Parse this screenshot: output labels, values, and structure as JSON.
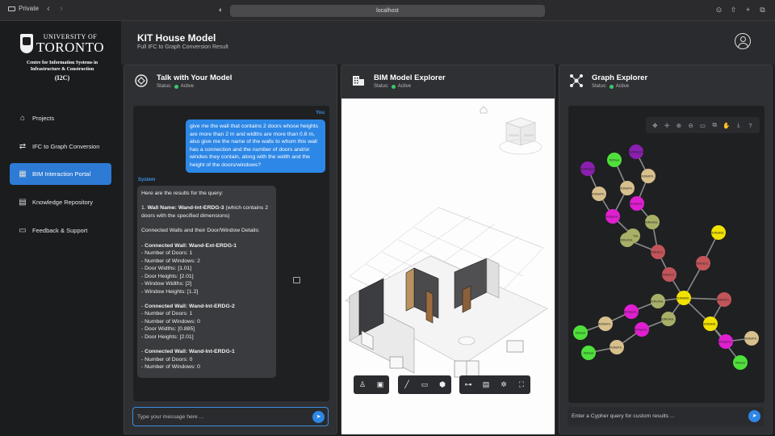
{
  "browser": {
    "private_label": "Private",
    "url": "localhost"
  },
  "sidebar": {
    "logo": {
      "line1": "UNIVERSITY OF",
      "line2": "TORONTO",
      "centre": "Centre for Information Systems in Infrastructure & Construction",
      "short": "(I2C)"
    },
    "items": [
      {
        "label": "Projects",
        "icon": "projects-icon"
      },
      {
        "label": "IFC to Graph Conversion",
        "icon": "ifc-icon"
      },
      {
        "label": "BIM Interaction Portal",
        "icon": "bim-portal-icon",
        "active": true
      },
      {
        "label": "Knowledge Repository",
        "icon": "book-icon"
      },
      {
        "label": "Feedback & Support",
        "icon": "feedback-icon"
      }
    ]
  },
  "header": {
    "title": "KIT House Model",
    "subtitle": "Full IFC to Graph Conversion Result"
  },
  "chat": {
    "title": "Talk with Your Model",
    "status_prefix": "Status:",
    "status": "Active",
    "you_label": "You",
    "user_message": "give me the wall that contains 2 doors whose heights are more than 2 m and widths are more than 0.8 m, also give me the name of the walls to whom this wall has a connection and the number of doors and/or windws they contain, along with the width and the height of the doors/windows?",
    "system_label": "System",
    "reply": {
      "intro": "Here are the results for the query:",
      "wall_prefix": "1. ",
      "wall_name": "Wall Name: Wand-Int-ERDG-3",
      "wall_suffix": " (which contains 2 doors with the specified dimensions)",
      "connected_heading": "Connected Walls and their Door/Window Details:",
      "connected": [
        {
          "name": "Connected Wall: Wand-Ext-ERDG-1",
          "details": [
            "- Number of Doors: 1",
            "- Number of Windows: 2",
            "- Door Widths: [1.01]",
            "- Door Heights: [2.01]",
            "- Window Widths: [2]",
            "- Window Heights: [1.2]"
          ]
        },
        {
          "name": "Connected Wall: Wand-Int-ERDG-2",
          "details": [
            "- Number of Doors: 1",
            "- Number of Windows: 0",
            "- Door Widths: [0.885]",
            "- Door Heights: [2.01]"
          ]
        },
        {
          "name": "Connected Wall: Wand-Int-ERDG-1",
          "details": [
            "- Number of Doors: 0",
            "- Number of Windows: 0"
          ]
        }
      ]
    },
    "input_placeholder": "Type your message here ..."
  },
  "bim": {
    "title": "BIM Model Explorer",
    "status_prefix": "Status:",
    "status": "Active",
    "viewcube": {
      "front": "FRONT",
      "right": "RIGHT"
    },
    "toolbar": [
      "person-icon",
      "camera-icon",
      "measure-icon",
      "folder-icon",
      "cube-icon",
      "hierarchy-icon",
      "properties-icon",
      "settings-icon",
      "fullscreen-icon"
    ]
  },
  "graph": {
    "title": "Graph Explorer",
    "status_prefix": "Status:",
    "status": "Active",
    "tools": [
      "layout-icon",
      "move-icon",
      "zoom-in-icon",
      "zoom-out-icon",
      "comment-icon",
      "copy-icon",
      "hand-icon",
      "download-icon",
      "help-icon"
    ],
    "input_placeholder": "Enter a Cypher query for custom results ...",
    "node_labels": [
      "IfcWindow",
      "IfcDoor",
      "IfcWindow",
      "IfcRelFil...",
      "IfcOpeni...",
      "IfcRelFil...",
      "IfcOpeni...",
      "IfcRelVoi...",
      "IfcRelVoi...",
      "IfcRelVoi...",
      "IfcRelCC...",
      "IfcRelCC...",
      "IfcWallSt...",
      "IfcRelCC...",
      "IfcOpeni...",
      "IfcRelVoi...",
      "IfcDoor",
      "IfcRelFil...",
      "IfcOpeni...",
      "IfcRelFil...",
      "IfcDoor",
      "IfcRelVoi...",
      "IfcRelCC...",
      "IfcRelCC...",
      "IfcOpeni...",
      "IfcRelFil...",
      "IfcDoor"
    ],
    "colors": {
      "IfcWindow": "#8a1fb0",
      "IfcDoor": "#4fe03c",
      "IfcRelFillsElement": "#d7c08c",
      "IfcOpeningElement": "#e01fd0",
      "IfcRelVoidsElement": "#a8b068",
      "IfcRelConnects": "#c2555a",
      "IfcWallStandardCase": "#f2e200"
    }
  }
}
